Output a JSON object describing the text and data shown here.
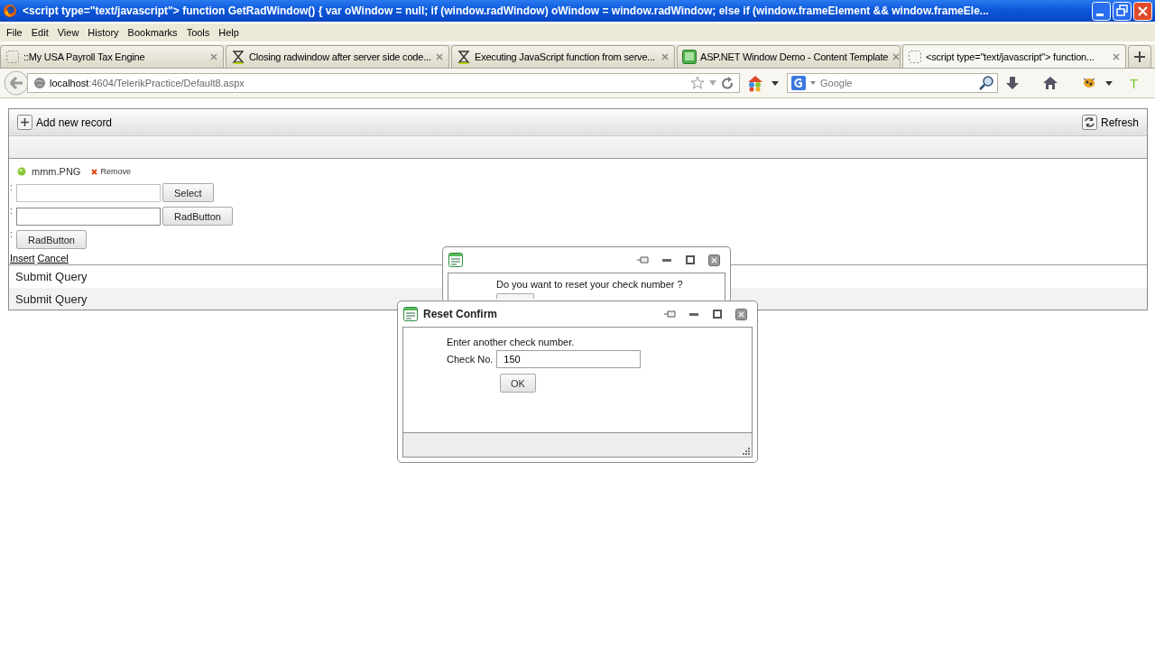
{
  "window": {
    "title": "<script type=\"text/javascript\"> function GetRadWindow() { var oWindow = null; if (window.radWindow) oWindow = window.radWindow; else if (window.frameElement && window.frameEle..."
  },
  "menu": [
    "File",
    "Edit",
    "View",
    "History",
    "Bookmarks",
    "Tools",
    "Help"
  ],
  "tabs": [
    {
      "label": "::My USA Payroll Tax Engine",
      "selected": false,
      "kind": "blank"
    },
    {
      "label": "Closing radwindow after server side code...",
      "selected": false,
      "kind": "hourglass"
    },
    {
      "label": "Executing JavaScript function from serve...",
      "selected": false,
      "kind": "hourglass"
    },
    {
      "label": "ASP.NET Window Demo - Content Template",
      "selected": false,
      "kind": "site"
    },
    {
      "label": "<script type=\"text/javascript\"> function...",
      "selected": true,
      "kind": "blank"
    }
  ],
  "address": {
    "host": "localhost",
    "path": ":4604/TelerikPractice/Default8.aspx"
  },
  "search": {
    "placeholder": "Google"
  },
  "toolbar": {
    "addon_letter": "T"
  },
  "grid": {
    "add_label": "Add new record",
    "refresh_label": "Refresh",
    "upload": {
      "file": "mmm.PNG",
      "remove": "Remove"
    },
    "fields": [
      {
        "kind": "upload",
        "label": ":",
        "button": "Select"
      },
      {
        "kind": "text",
        "label": ":",
        "button": "RadButton"
      },
      {
        "kind": "button",
        "label": ":",
        "button": "RadButton"
      }
    ],
    "links": [
      "Insert",
      "Cancel"
    ],
    "rows": [
      "Submit Query",
      "Submit Query"
    ]
  },
  "dialogs": [
    {
      "message": "Do you want to reset your check number ?"
    },
    {
      "title": "Reset Confirm",
      "message": "Enter another check number.",
      "field_label": "Check No.",
      "value": "150",
      "button": "OK"
    }
  ]
}
